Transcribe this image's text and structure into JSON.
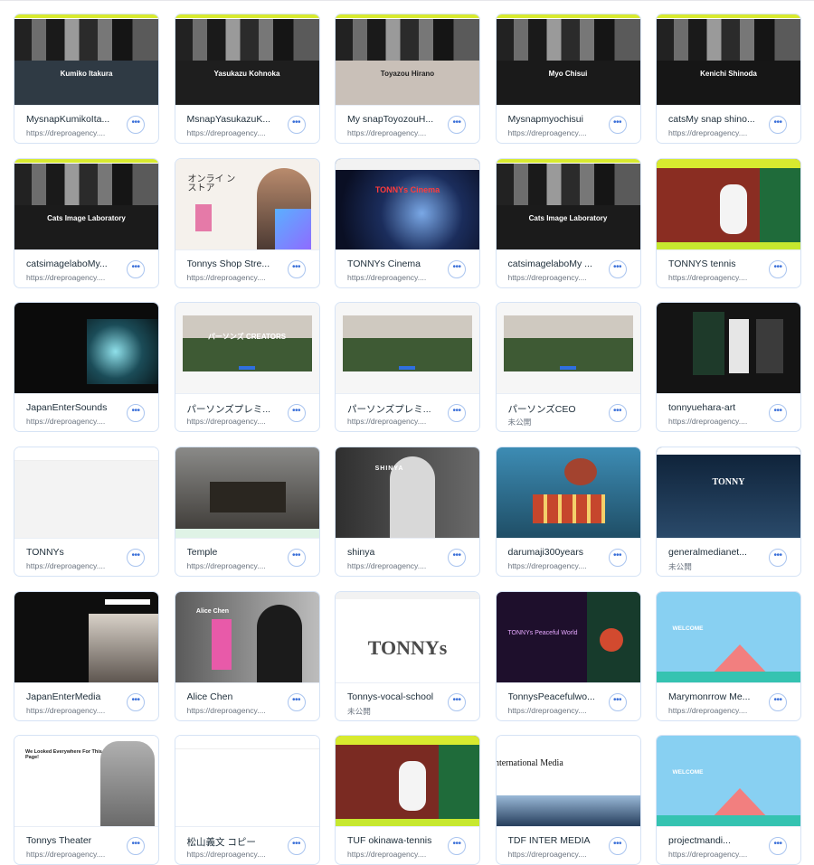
{
  "cards": [
    {
      "name": "MysnapKumikoIta...",
      "url": "https://dreproagency....",
      "thumb": "snap",
      "overlay": "Kumiko Itakura",
      "bg": "#2f3a44"
    },
    {
      "name": "MsnapYasukazuK...",
      "url": "https://dreproagency....",
      "thumb": "snap",
      "overlay": "Yasukazu Kohnoka",
      "bg": "#1e1e1e"
    },
    {
      "name": "My snapToyozouH...",
      "url": "https://dreproagency....",
      "thumb": "snap",
      "overlay": "Toyazou Hirano",
      "bg": "#c9c0b8"
    },
    {
      "name": "Mysnapmyochisui",
      "url": "https://dreproagency....",
      "thumb": "snap",
      "overlay": "Myo Chisui",
      "bg": "#1a1a1a"
    },
    {
      "name": "catsMy snap shino...",
      "url": "https://dreproagency....",
      "thumb": "snap",
      "overlay": "Kenichi Shinoda",
      "bg": "#161616"
    },
    {
      "name": "catsimagelaboMy...",
      "url": "https://dreproagency....",
      "thumb": "snap",
      "overlay": "Cats Image Laboratory",
      "bg": "#1b1b1b"
    },
    {
      "name": "Tonnys Shop Stre...",
      "url": "https://dreproagency....",
      "thumb": "shop",
      "overlay": "オンライ ンストア",
      "bg": "#f5f1ec"
    },
    {
      "name": "TONNYs Cinema",
      "url": "https://dreproagency....",
      "thumb": "space",
      "overlay": "TONNYs Cinema",
      "bg": "#0f1a3a"
    },
    {
      "name": "catsimagelaboMy ...",
      "url": "https://dreproagency....",
      "thumb": "snap",
      "overlay": "Cats Image Laboratory",
      "bg": "#1b1b1b"
    },
    {
      "name": "TONNYS tennis",
      "url": "https://dreproagency....",
      "thumb": "tennis",
      "overlay": "",
      "bg": "#8a2d22"
    },
    {
      "name": "JapanEnterSounds",
      "url": "https://dreproagency....",
      "thumb": "sound",
      "overlay": "",
      "bg": "#0e0e0e"
    },
    {
      "name": "パーソンズプレミ...",
      "url": "https://dreproagency....",
      "thumb": "field",
      "overlay": "パーソンズ CREATORS",
      "bg": "#405a3a"
    },
    {
      "name": "パーソンズプレミ...",
      "url": "https://dreproagency....",
      "thumb": "field",
      "overlay": "",
      "bg": "#405a3a"
    },
    {
      "name": "パーソンズCEO",
      "url": "未公開",
      "thumb": "field2",
      "overlay": "",
      "bg": "#4b6b48"
    },
    {
      "name": "tonnyuehara-art",
      "url": "https://dreproagency....",
      "thumb": "art",
      "overlay": "",
      "bg": "#141414"
    },
    {
      "name": "TONNYs",
      "url": "https://dreproagency....",
      "thumb": "blank",
      "overlay": "",
      "bg": "#f4f4f4"
    },
    {
      "name": "Temple",
      "url": "https://dreproagency....",
      "thumb": "temple",
      "overlay": "",
      "bg": "#6d6a66"
    },
    {
      "name": "shinya",
      "url": "https://dreproagency....",
      "thumb": "portrait",
      "overlay": "SHINYA",
      "bg": "#4a4a4a"
    },
    {
      "name": "darumaji300years",
      "url": "https://dreproagency....",
      "thumb": "daruma",
      "overlay": "",
      "bg": "#2f6f8f"
    },
    {
      "name": "generalmedianet...",
      "url": "未公開",
      "thumb": "city",
      "overlay": "TONNY",
      "bg": "#18324a"
    },
    {
      "name": "JapanEnterMedia",
      "url": "https://dreproagency....",
      "thumb": "media",
      "overlay": "",
      "bg": "#111111"
    },
    {
      "name": "Alice Chen",
      "url": "https://dreproagency....",
      "thumb": "alice",
      "overlay": "Alice Chen",
      "bg": "#3a3a3a"
    },
    {
      "name": "Tonnys-vocal-school",
      "url": "未公開",
      "thumb": "vocal",
      "overlay": "TONNYs",
      "bg": "#ffffff"
    },
    {
      "name": "TonnysPeacefulwo...",
      "url": "https://dreproagency....",
      "thumb": "peace",
      "overlay": "TONNYs Peaceful World",
      "bg": "#1e0f2c"
    },
    {
      "name": "Marymonrrow Me...",
      "url": "https://dreproagency....",
      "thumb": "welcome",
      "overlay": "WELCOME",
      "bg": "#88d0f2"
    },
    {
      "name": "Tonnys Theater",
      "url": "https://dreproagency....",
      "thumb": "theater",
      "overlay": "We Looked Everywhere For This Page!",
      "bg": "#ffffff"
    },
    {
      "name": "松山義文 コピー",
      "url": "https://dreproagency....",
      "thumb": "blank2",
      "overlay": "",
      "bg": "#ffffff"
    },
    {
      "name": "TUF okinawa-tennis",
      "url": "https://dreproagency....",
      "thumb": "tennis2",
      "overlay": "",
      "bg": "#7a2a22"
    },
    {
      "name": "TDF INTER MEDIA",
      "url": "https://dreproagency....",
      "thumb": "tdf",
      "overlay": "TDF International Media",
      "bg": "#ffffff"
    },
    {
      "name": "projectmandi...",
      "url": "https://dreproagency....",
      "thumb": "welcome",
      "overlay": "WELCOME",
      "bg": "#88d0f2"
    }
  ],
  "more_label": "•••"
}
